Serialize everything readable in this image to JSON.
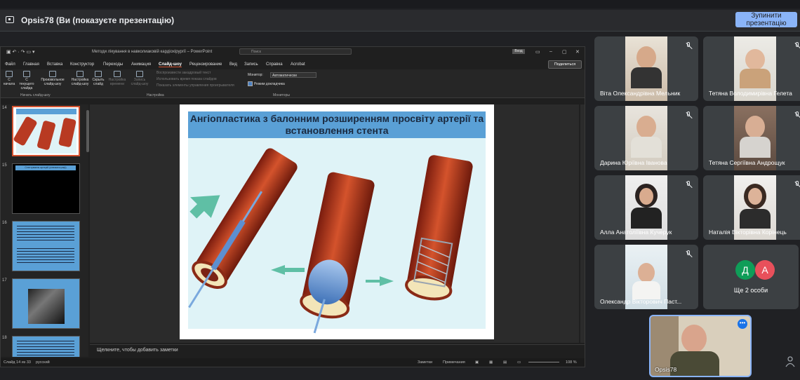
{
  "meet": {
    "presenting_label": "Opsis78 (Ви (показуєте презентацію)",
    "stop_button": "Зупинити презентацію"
  },
  "ppt": {
    "title": "Методи лікування в навколиаковій кардіохірургії  –  PowerPoint",
    "search_placeholder": "Поиск",
    "login_label": "Вход",
    "quick_icons": "▣ ↶ · ↷ ▭ ▾",
    "tabs": [
      "Файл",
      "Главная",
      "Вставка",
      "Конструктор",
      "Переходы",
      "Анимация",
      "Слайд-шоу",
      "Рецензирование",
      "Вид",
      "Запись",
      "Справка",
      "Acrobat"
    ],
    "active_tab": "Слайд-шоу",
    "share_label": "Поделиться",
    "ribbon": {
      "from_start": "С начала",
      "from_current": "С текущего слайда",
      "custom": "Произвольное слайд-шоу",
      "setup": "Настройка слайд-шоу",
      "hide": "Скрыть слайд",
      "rehearse": "Настройка времени",
      "record": "Запись слайд-шоу",
      "opt1": "Воспроизвести закадровый текст",
      "opt2": "Использовать время показа слайдов",
      "opt3": "Показать элементы управления проигрывателя",
      "monitor_label": "Монитор:",
      "monitor_value": "Автоматически",
      "presenter_view": "Режим докладчика",
      "group_start": "Начать слайд-шоу",
      "group_setup": "Настройка",
      "group_monitors": "Мониторы"
    },
    "thumb_numbers": [
      "14",
      "15",
      "16",
      "17",
      "18"
    ],
    "thumb15_text": "Стентування артерій (кінематограф)",
    "slide_title": "Ангіопластика з балонним розширенням просвіту артерії та встановлення стента",
    "notes_placeholder": "Щелкните, чтобы добавить заметки",
    "status_slide": "Слайд 14 из 33",
    "status_lang": "русский",
    "status_notes": "Заметки",
    "status_comments": "Примечания",
    "zoom": "108 %"
  },
  "participants": [
    {
      "name": "Віта Олександрівна Мельник",
      "muted": true
    },
    {
      "name": "Тетяна Володимирівна Гелета",
      "muted": true
    },
    {
      "name": "Дарина Юріївна Іванова",
      "muted": true
    },
    {
      "name": "Тетяна Сергіївна Андрощук",
      "muted": true
    },
    {
      "name": "Алла Анатоліївна Кучерук",
      "muted": true
    },
    {
      "name": "Наталія Вікторівна Корінець",
      "muted": true
    },
    {
      "name": "Олександр Вікторович Паст...",
      "muted": true
    }
  ],
  "more": {
    "avatar1": "Д",
    "avatar2": "А",
    "label": "Ще 2 особи",
    "avatar1_color": "#0f9d58",
    "avatar2_color": "#e8505b"
  },
  "self": {
    "name": "Opsis78",
    "menu": "•••"
  },
  "colors": {
    "accent": "#8ab4f8",
    "ppt_accent": "#d35230",
    "slide_title_bg": "#5aa0d6"
  }
}
